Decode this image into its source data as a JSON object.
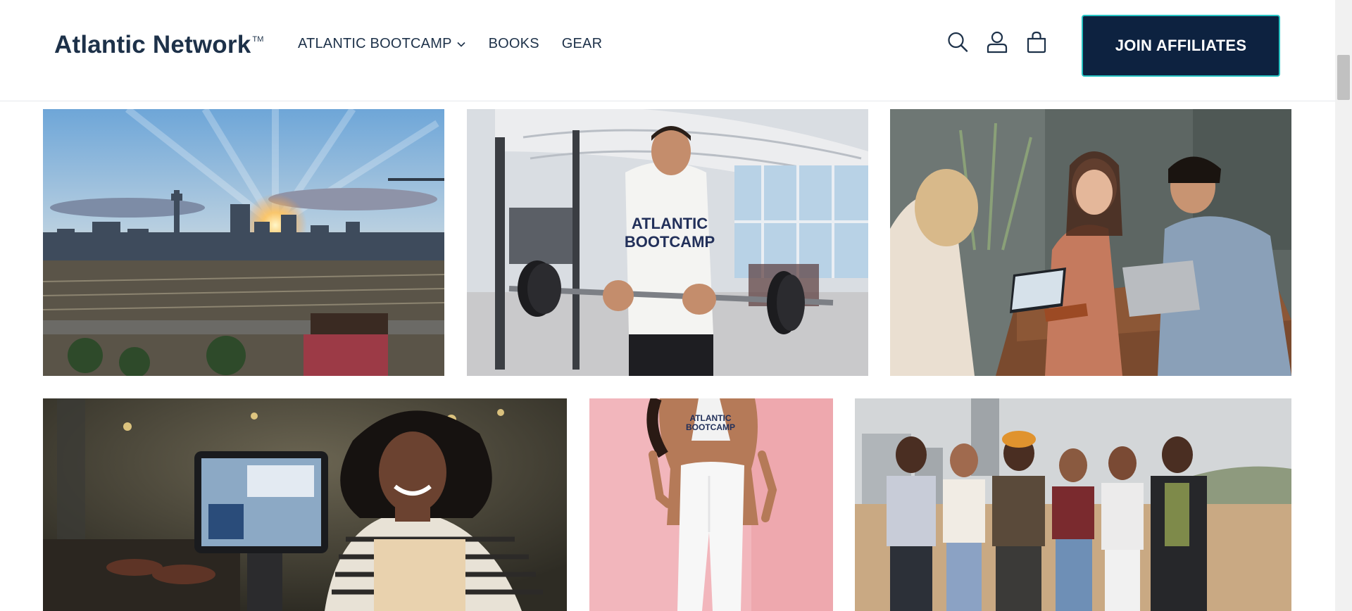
{
  "header": {
    "logo": "Atlantic Network",
    "logo_mark": "TM",
    "nav": [
      {
        "label": "ATLANTIC BOOTCAMP",
        "has_dropdown": true
      },
      {
        "label": "BOOKS"
      },
      {
        "label": "GEAR"
      }
    ],
    "icons": [
      "search-icon",
      "account-icon",
      "cart-icon"
    ],
    "cta_label": "JOIN AFFILIATES"
  },
  "colors": {
    "brand_text": "#1d3149",
    "cta_bg": "#0d2240",
    "cta_border": "#27c3c3"
  },
  "gallery": {
    "row1": [
      "city-skyline-sunset-image",
      "gym-barbell-curl-image",
      "cafe-laptop-meeting-image"
    ],
    "row2": [
      "cashier-smiling-image",
      "athletic-wear-model-image",
      "group-friends-rooftop-image"
    ],
    "shirt_text": [
      "ATLANTIC",
      "BOOTCAMP"
    ]
  }
}
